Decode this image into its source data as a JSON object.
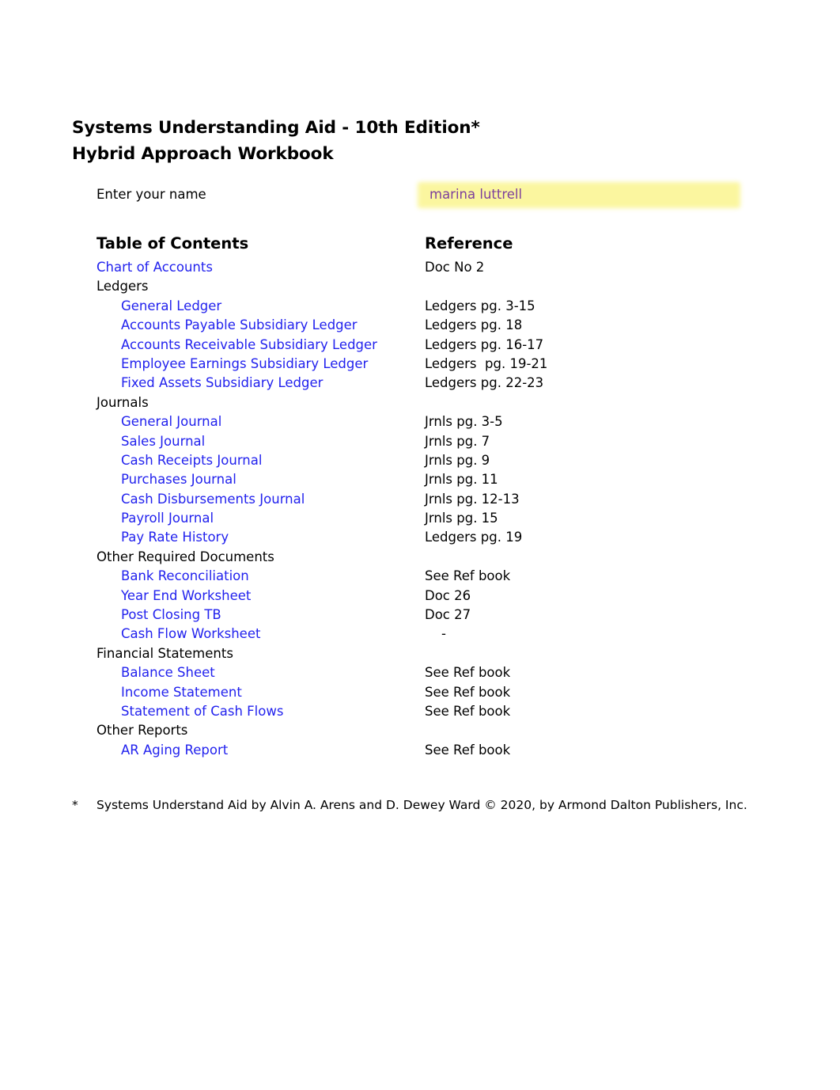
{
  "document": {
    "title_line_1": "Systems Understanding Aid - 10th Edition*",
    "title_line_2": "Hybrid Approach Workbook"
  },
  "name_field": {
    "label": "Enter your name",
    "value": "marina luttrell",
    "highlight_color": "#fbf69a",
    "text_color": "#7d3f9c"
  },
  "headers": {
    "toc": "Table of Contents",
    "reference": "Reference"
  },
  "link_color": "#2222ee",
  "rows": [
    {
      "label": "Chart of Accounts",
      "level": 0,
      "link": true,
      "ref": "Doc No 2",
      "ref_indented": false
    },
    {
      "label": "Ledgers",
      "level": 0,
      "link": false,
      "ref": "",
      "ref_indented": false
    },
    {
      "label": "General Ledger",
      "level": 1,
      "link": true,
      "ref": "Ledgers pg. 3-15",
      "ref_indented": false
    },
    {
      "label": "Accounts Payable Subsidiary Ledger",
      "level": 1,
      "link": true,
      "ref": "Ledgers pg. 18",
      "ref_indented": false
    },
    {
      "label": "Accounts Receivable Subsidiary Ledger",
      "level": 1,
      "link": true,
      "ref": "Ledgers pg. 16-17",
      "ref_indented": false
    },
    {
      "label": "Employee Earnings Subsidiary Ledger",
      "level": 1,
      "link": true,
      "ref": "Ledgers  pg. 19-21",
      "ref_indented": false
    },
    {
      "label": "Fixed Assets Subsidiary Ledger",
      "level": 1,
      "link": true,
      "ref": "Ledgers pg. 22-23",
      "ref_indented": false
    },
    {
      "label": "Journals",
      "level": 0,
      "link": false,
      "ref": "",
      "ref_indented": false
    },
    {
      "label": "General Journal",
      "level": 1,
      "link": true,
      "ref": "Jrnls pg. 3-5",
      "ref_indented": false
    },
    {
      "label": "Sales Journal",
      "level": 1,
      "link": true,
      "ref": "Jrnls pg. 7",
      "ref_indented": false
    },
    {
      "label": "Cash Receipts Journal",
      "level": 1,
      "link": true,
      "ref": "Jrnls pg. 9",
      "ref_indented": false
    },
    {
      "label": "Purchases Journal",
      "level": 1,
      "link": true,
      "ref": "Jrnls pg. 11",
      "ref_indented": false
    },
    {
      "label": "Cash Disbursements Journal",
      "level": 1,
      "link": true,
      "ref": "Jrnls pg. 12-13",
      "ref_indented": false
    },
    {
      "label": "Payroll Journal",
      "level": 1,
      "link": true,
      "ref": "Jrnls pg. 15",
      "ref_indented": false
    },
    {
      "label": "Pay Rate History",
      "level": 1,
      "link": true,
      "ref": "Ledgers pg. 19",
      "ref_indented": false
    },
    {
      "label": "Other Required Documents",
      "level": 0,
      "link": false,
      "ref": "",
      "ref_indented": false
    },
    {
      "label": "Bank Reconciliation",
      "level": 1,
      "link": true,
      "ref": "See Ref book",
      "ref_indented": false
    },
    {
      "label": "Year End Worksheet",
      "level": 1,
      "link": true,
      "ref": "Doc 26",
      "ref_indented": false
    },
    {
      "label": "Post Closing TB",
      "level": 1,
      "link": true,
      "ref": "Doc 27",
      "ref_indented": false
    },
    {
      "label": "Cash Flow Worksheet",
      "level": 1,
      "link": true,
      "ref": "-",
      "ref_indented": true
    },
    {
      "label": "Financial Statements",
      "level": 0,
      "link": false,
      "ref": "",
      "ref_indented": false
    },
    {
      "label": "Balance Sheet",
      "level": 1,
      "link": true,
      "ref": "See Ref book",
      "ref_indented": false
    },
    {
      "label": "Income Statement",
      "level": 1,
      "link": true,
      "ref": "See Ref book",
      "ref_indented": false
    },
    {
      "label": "Statement of Cash Flows",
      "level": 1,
      "link": true,
      "ref": "See Ref book",
      "ref_indented": false
    },
    {
      "label": "Other Reports",
      "level": 0,
      "link": false,
      "ref": "",
      "ref_indented": false
    },
    {
      "label": "AR Aging Report",
      "level": 1,
      "link": true,
      "ref": "See Ref book",
      "ref_indented": false
    }
  ],
  "footnote": {
    "mark": "*",
    "text": "Systems Understand Aid by Alvin A. Arens and D. Dewey Ward © 2020, by Armond Dalton Publishers, Inc."
  }
}
